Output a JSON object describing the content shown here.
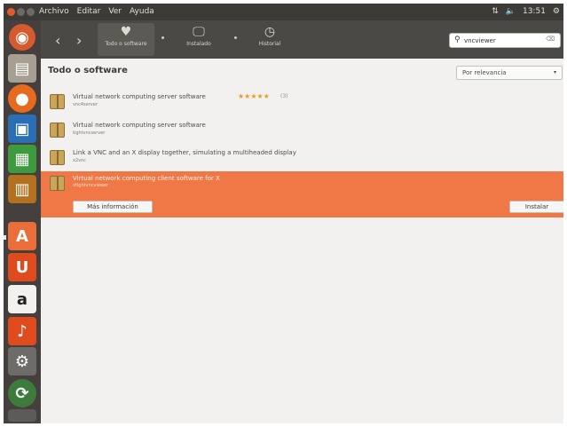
{
  "menubar": {
    "menu": [
      "Archivo",
      "Editar",
      "Ver",
      "Ayuda"
    ],
    "clock": "13:51"
  },
  "launcher": {
    "items": [
      "dash-icon",
      "files-icon",
      "firefox-icon",
      "writer-icon",
      "calc-icon",
      "impress-icon",
      "software-center-icon",
      "ubuntu-one-icon",
      "amazon-icon",
      "ubuntu-one-music-icon",
      "system-settings-icon",
      "update-icon",
      "trash-icon"
    ]
  },
  "toolbar": {
    "back_label": "‹",
    "forward_label": "›",
    "tabs": [
      {
        "label": "Todo o software",
        "icon": "♥"
      },
      {
        "label": "Instalado",
        "icon": "🖵"
      },
      {
        "label": "Historial",
        "icon": "◷"
      }
    ],
    "search": {
      "value": "vncviewer",
      "placeholder": "",
      "clear": "⌫"
    }
  },
  "main": {
    "title": "Todo o software",
    "sort": {
      "selected": "Por relevancia"
    },
    "results": [
      {
        "title": "Virtual network computing server software",
        "package": "vnc4server",
        "stars": "★★★★★",
        "count": "(3)"
      },
      {
        "title": "Virtual network computing server software",
        "package": "tightvncserver"
      },
      {
        "title": "Link a VNC and an X display together, simulating a multiheaded display",
        "package": "x2vnc"
      },
      {
        "title": "Virtual network computing client software for X",
        "package": "xtightvncviewer",
        "selected": true
      }
    ],
    "more_info_label": "Más información",
    "install_label": "Instalar"
  },
  "colors": {
    "selection": "#f07746",
    "launcher_bg": "#45403e",
    "toolbar_bg": "#4a4945",
    "stars": "#e39f1a"
  }
}
